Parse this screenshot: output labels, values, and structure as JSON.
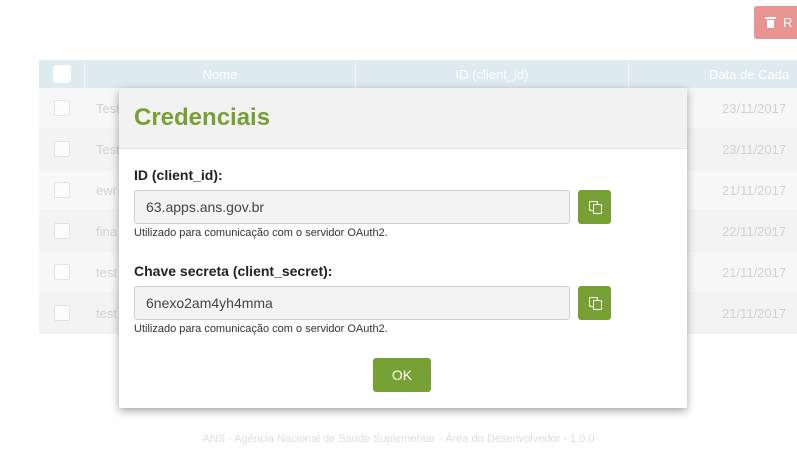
{
  "toolbar": {
    "remove_label": "R"
  },
  "table": {
    "headers": {
      "name": "Nome",
      "client_id": "ID (client_id)",
      "date": "Data de Cada"
    },
    "rows": [
      {
        "name": "Test",
        "date": "23/11/2017"
      },
      {
        "name": "Test",
        "date": "23/11/2017"
      },
      {
        "name": "ewr",
        "date": "21/11/2017"
      },
      {
        "name": "fina",
        "date": "22/11/2017"
      },
      {
        "name": "test",
        "date": "21/11/2017"
      },
      {
        "name": "test",
        "date": "21/11/2017"
      }
    ]
  },
  "modal": {
    "title": "Credenciais",
    "client_id": {
      "label": "ID (client_id):",
      "value": "63.apps.ans.gov.br",
      "help": "Utilizado para comunicação com o servidor OAuth2."
    },
    "client_secret": {
      "label": "Chave secreta (client_secret):",
      "value": "6nexo2am4yh4mma",
      "help": "Utilizado para comunicação com o servidor OAuth2."
    },
    "ok_label": "OK"
  },
  "footer": {
    "text": "ANS - Agência Nacional de Saúde Suplementar - Área do Desenvolvedor - 1.0.0"
  },
  "colors": {
    "accent": "#76a033",
    "danger": "#d9534f",
    "table_header": "#c9dde7"
  },
  "icons": {
    "remove": "trash-icon",
    "copy": "copy-icon"
  }
}
